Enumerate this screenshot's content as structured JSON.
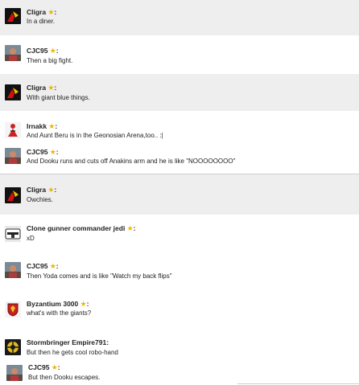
{
  "messages": [
    {
      "username": "Cligra",
      "text": "In a diner.",
      "avatar_icon": "black-red-emblem-icon"
    },
    {
      "username": "CJC95",
      "text": "Then a big fight.",
      "avatar_icon": "portrait-photo-icon"
    },
    {
      "username": "Cligra",
      "text": "With giant blue things.",
      "avatar_icon": "black-red-emblem-icon"
    },
    {
      "username": "Irnakk",
      "text": "And Aunt Beru is in the Geonosian Arena,too.. :|",
      "avatar_icon": "red-figure-icon"
    },
    {
      "username": "CJC95",
      "text": "And Dooku runs and cuts off Anakins arm and he is like \"NOOOOOOOO\"",
      "avatar_icon": "portrait-photo-icon"
    },
    {
      "username": "Cligra",
      "text": "Owchies.",
      "avatar_icon": "black-red-emblem-icon"
    },
    {
      "username": "Clone gunner commander jedi",
      "text": "xD",
      "avatar_icon": "clone-helmet-icon"
    },
    {
      "username": "CJC95",
      "text": "Then Yoda comes and is like \"Watch my back flips\"",
      "avatar_icon": "portrait-photo-icon"
    },
    {
      "username": "Byzantium 3000",
      "text": "what's with the giants?",
      "avatar_icon": "crest-shield-icon"
    },
    {
      "username": "Stormbringer Empire791",
      "text": "But then he gets cool robo-hand",
      "avatar_icon": "yellow-emblem-icon"
    },
    {
      "username": "CJC95",
      "text": "But then Dooku escapes.",
      "avatar_icon": "portrait-photo-icon"
    }
  ],
  "star_glyph": "★",
  "colon": ":",
  "colors": {
    "star": "#f0b400",
    "shaded_row": "#eeeeee",
    "divider": "#cfcfcf"
  }
}
